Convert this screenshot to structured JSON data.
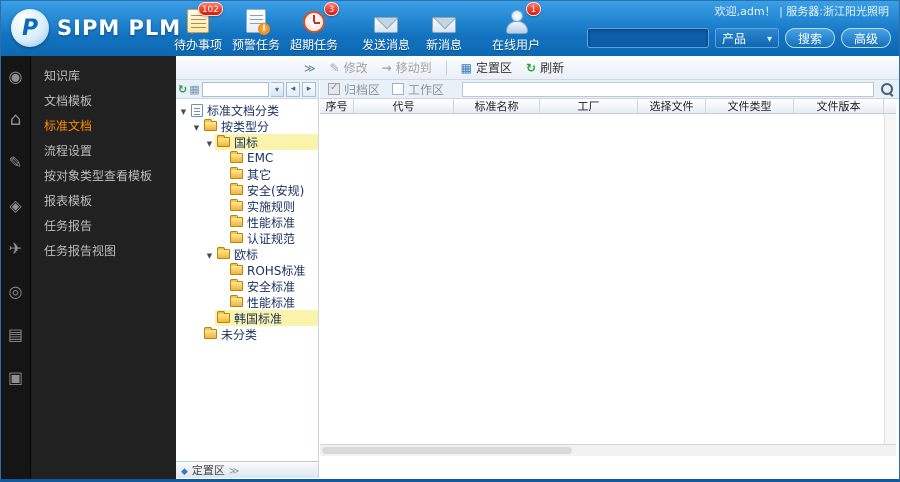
{
  "topbar": {
    "welcome": "欢迎,adm！ | 服务器:浙江阳光照明",
    "logo": {
      "text": "SIPM PLM",
      "letter": "P"
    },
    "nav": [
      {
        "label": "待办事项",
        "badge": "102"
      },
      {
        "label": "预警任务",
        "badge": ""
      },
      {
        "label": "超期任务",
        "badge": "3"
      },
      {
        "label": "发送消息",
        "badge": ""
      },
      {
        "label": "新消息",
        "badge": ""
      },
      {
        "label": "在线用户",
        "badge": "1"
      }
    ],
    "search": {
      "value": "",
      "category": "产品",
      "search_button": "搜索",
      "advanced_button": "高级"
    }
  },
  "sidebar": {
    "items": [
      {
        "label": "知识库"
      },
      {
        "label": "文档模板"
      },
      {
        "label": "标准文档"
      },
      {
        "label": "流程设置"
      },
      {
        "label": "按对象类型查看模板"
      },
      {
        "label": "报表模板"
      },
      {
        "label": "任务报告"
      },
      {
        "label": "任务报告视图"
      }
    ]
  },
  "toolbar": {
    "modify": "修改",
    "move_to": "移动到",
    "fixed_zone": "定置区",
    "refresh": "刷新"
  },
  "filter": {
    "archive_area": "归档区",
    "work_area": "工作区",
    "search_value": ""
  },
  "tree": {
    "nodes": [
      {
        "label": "标准文档分类"
      },
      {
        "label": "按类型分"
      },
      {
        "label": "国标"
      },
      {
        "label": "EMC"
      },
      {
        "label": "其它"
      },
      {
        "label": "安全(安规)"
      },
      {
        "label": "实施规则"
      },
      {
        "label": "性能标准"
      },
      {
        "label": "认证规范"
      },
      {
        "label": "欧标"
      },
      {
        "label": "ROHS标准"
      },
      {
        "label": "安全标准"
      },
      {
        "label": "性能标准"
      },
      {
        "label": "韩国标准"
      },
      {
        "label": "未分类"
      }
    ],
    "bottom_bar_label": "定置区"
  },
  "grid": {
    "headers": [
      "序号",
      "代号",
      "标准名称",
      "工厂",
      "选择文件",
      "文件类型",
      "文件版本"
    ],
    "rows": []
  }
}
